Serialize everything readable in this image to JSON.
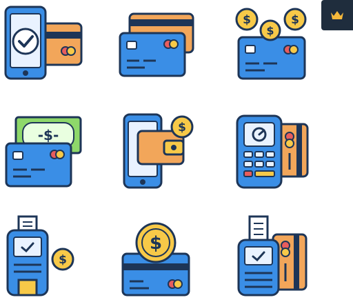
{
  "badge": {
    "icon": "crown-icon",
    "color": "#f6b93b",
    "background": "#1f2d3d"
  },
  "palette": {
    "outline": "#1d3557",
    "blue": "#3a8ee6",
    "yellow": "#f7c948",
    "orange": "#f2a65a",
    "green": "#8ed86a",
    "light": "#e9f2ff",
    "red": "#e85d5d"
  },
  "icons": [
    {
      "name": "phone-payment-check-icon"
    },
    {
      "name": "stacked-credit-cards-icon"
    },
    {
      "name": "card-with-coins-icon"
    },
    {
      "name": "cash-and-card-icon"
    },
    {
      "name": "phone-wallet-coin-icon"
    },
    {
      "name": "card-terminal-icon"
    },
    {
      "name": "portable-terminal-coin-icon"
    },
    {
      "name": "coin-on-card-icon"
    },
    {
      "name": "terminal-receipt-card-icon"
    }
  ],
  "glyphs": {
    "dollar": "$",
    "cash_label": "-$-"
  }
}
